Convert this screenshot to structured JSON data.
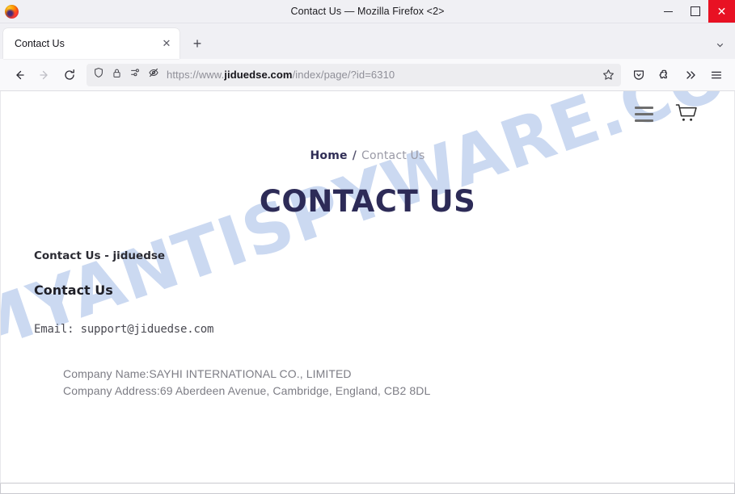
{
  "window": {
    "title": "Contact Us — Mozilla Firefox <2>",
    "logo_icon": "firefox-logo",
    "controls": {
      "minimize": "minimize-icon",
      "maximize": "maximize-icon",
      "close": "close-icon",
      "close_glyph": "✕"
    },
    "close_color": "#e81123"
  },
  "tabbar": {
    "tabs": [
      {
        "title": "Contact Us",
        "close_glyph": "✕",
        "active": true
      }
    ],
    "new_tab_glyph": "+",
    "new_tab_label": "Open a new tab",
    "list_all_tabs_glyph": "⌄",
    "list_all_tabs_label": "List all tabs"
  },
  "toolbar": {
    "back_label": "Go back one page",
    "forward_label": "Go forward one page",
    "reload_label": "Reload current page",
    "url": {
      "scheme": "https://www.",
      "host": "jiduedse.com",
      "path": "/index/page/?id=6310",
      "full": "https://www.jiduedse.com/index/page/?id=6310"
    },
    "identity_icons": [
      "shield-icon",
      "padlock-icon",
      "permissions-icon",
      "autoplay-blocked-icon"
    ],
    "bookmark_label": "Bookmark this page",
    "right_icons": [
      "pocket-icon",
      "extensions-icon",
      "overflow-icon",
      "app-menu-icon"
    ],
    "overflow_glyph": "»"
  },
  "page": {
    "watermark": "MYANTISPYWARE.COM",
    "watermark_color": "#c3d3ef",
    "site_header": {
      "menu_icon": "hamburger-menu-icon",
      "cart_icon": "shopping-cart-icon"
    },
    "breadcrumb": {
      "home": "Home",
      "separator": "/",
      "current": "Contact Us"
    },
    "title": "CONTACT US",
    "title_color": "#2d2b57",
    "lead": "Contact Us - jiduedse",
    "subheading": "Contact Us",
    "email_line": "Email: support@jiduedse.com",
    "company": {
      "name_line": "Company Name:SAYHI INTERNATIONAL CO., LIMITED",
      "address_line": "Company Address:69 Aberdeen Avenue, Cambridge, England, CB2 8DL"
    }
  }
}
